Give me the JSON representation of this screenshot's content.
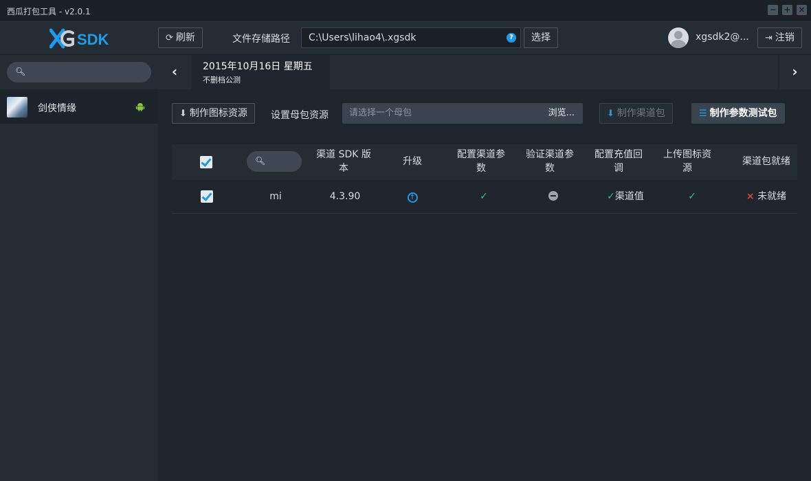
{
  "window": {
    "title": "西瓜打包工具 - v2.0.1",
    "controls": [
      "−",
      "+",
      "×"
    ]
  },
  "header": {
    "logo_text": "SDK",
    "refresh_label": "刷新",
    "path_label": "文件存储路径",
    "path_value": "C:\\Users\\lihao4\\.xgsdk",
    "help_icon": "?",
    "choose_label": "选择",
    "username": "xgsdk2@...",
    "logout_label": "注销"
  },
  "sidebar": {
    "search_placeholder": "",
    "games": [
      {
        "name": "剑侠情缘",
        "platform": "android-icon"
      }
    ]
  },
  "datebar": {
    "date": "2015年10月16日 星期五",
    "subtitle": "不删档公测"
  },
  "toolbar": {
    "make_icon_res_label": "制作图标资源",
    "mother_pkg_label": "设置母包资源",
    "mother_pkg_placeholder": "请选择一个母包",
    "browse_label": "浏览...",
    "make_channel_pkg_label": "制作渠道包",
    "make_test_pkg_label": "制作参数测试包"
  },
  "table": {
    "headers": {
      "sdk_version": "渠道 SDK 版本",
      "upgrade": "升级",
      "config_params": "配置渠道参数",
      "verify_params": "验证渠道参数",
      "config_callback": "配置充值回调",
      "upload_icon": "上传图标资源",
      "pkg_ready": "渠道包就绪"
    },
    "rows": [
      {
        "checked": true,
        "channel": "mi",
        "sdk_version": "4.3.90",
        "upgrade": "upgrade-icon",
        "config_params": "✓",
        "verify_params": "minus-icon",
        "config_callback_mark": "✓",
        "config_callback_text": "渠道值",
        "upload_icon": "✓",
        "pkg_ready_mark": "×",
        "pkg_ready_text": "未就绪"
      }
    ]
  },
  "colors": {
    "accent": "#1e9be8",
    "success": "#2ec27e",
    "error": "#e2453c",
    "android": "#8cc63f"
  }
}
